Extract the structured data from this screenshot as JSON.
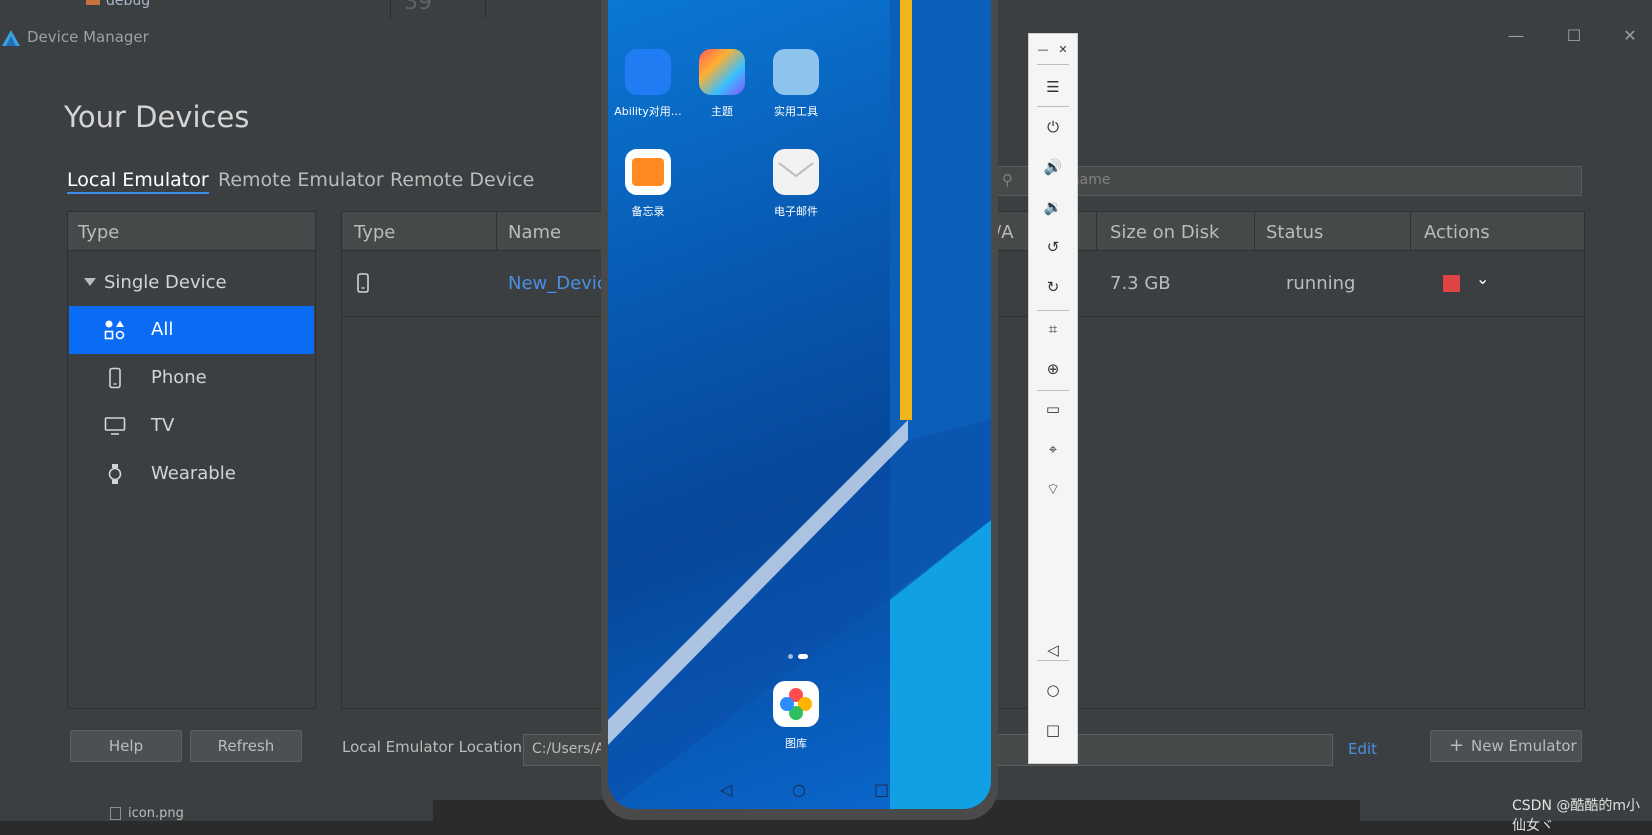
{
  "ide": {
    "top_text": "debug",
    "top_number": "39",
    "bottom_file": "icon.png",
    "watermark": "CSDN @酷酷的m小仙女ヾ"
  },
  "window": {
    "title": "Device Manager",
    "minimize": "—",
    "maximize": "☐",
    "close": "✕"
  },
  "heading": "Your Devices",
  "tabs": [
    {
      "label": "Local Emulator",
      "active": true
    },
    {
      "label": "Remote Emulator",
      "active": false
    },
    {
      "label": "Remote Device",
      "active": false
    }
  ],
  "search": {
    "text": "y name"
  },
  "sidebar": {
    "header": "Type",
    "root": "Single Device",
    "items": [
      {
        "label": "All",
        "icon": "grid-shapes-icon",
        "selected": true
      },
      {
        "label": "Phone",
        "icon": "phone-icon",
        "selected": false
      },
      {
        "label": "TV",
        "icon": "tv-icon",
        "selected": false
      },
      {
        "label": "Wearable",
        "icon": "watch-icon",
        "selected": false
      }
    ]
  },
  "table": {
    "columns": [
      "Type",
      "Name",
      "U/A",
      "Size on Disk",
      "Status",
      "Actions"
    ],
    "rows": [
      {
        "name": "New_Devic",
        "size": "7.3 GB",
        "status": "running"
      }
    ]
  },
  "footer": {
    "help": "Help",
    "refresh": "Refresh",
    "location_label": "Local Emulator Location:",
    "location_value": "C:/Users/A",
    "edit": "Edit",
    "new_emulator": "New Emulator"
  },
  "phone": {
    "apps": [
      "Ability对用…",
      "主题",
      "实用工具",
      "备忘录",
      "电子邮件",
      "图库"
    ]
  },
  "colors": {
    "accent": "#0a6cf5",
    "link": "#4a90e2",
    "stop": "#e04343"
  }
}
